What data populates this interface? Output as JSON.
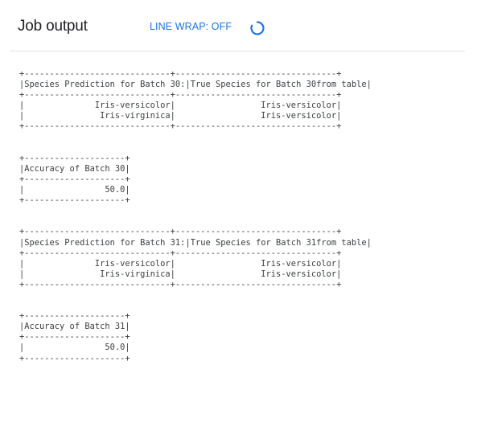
{
  "header": {
    "title": "Job output",
    "line_wrap_label": "LINE WRAP: OFF"
  },
  "icons": {
    "spinner": "loading-spinner-icon"
  },
  "colors": {
    "accent": "#1a73e8",
    "text": "#202124",
    "output_text": "#3c4043"
  },
  "output": {
    "tables": [
      {
        "lines": [
          "+-----------------------------+--------------------------------+",
          "|Species Prediction for Batch 30:|True Species for Batch 30from table|",
          "+-----------------------------+--------------------------------+",
          "|              Iris-versicolor|                 Iris-versicolor|",
          "|               Iris-virginica|                 Iris-versicolor|",
          "+-----------------------------+--------------------------------+"
        ]
      },
      {
        "lines": [
          "+--------------------+",
          "|Accuracy of Batch 30|",
          "+--------------------+",
          "|                50.0|",
          "+--------------------+"
        ]
      },
      {
        "lines": [
          "+-----------------------------+--------------------------------+",
          "|Species Prediction for Batch 31:|True Species for Batch 31from table|",
          "+-----------------------------+--------------------------------+",
          "|              Iris-versicolor|                 Iris-versicolor|",
          "|               Iris-virginica|                 Iris-versicolor|",
          "+-----------------------------+--------------------------------+"
        ]
      },
      {
        "lines": [
          "+--------------------+",
          "|Accuracy of Batch 31|",
          "+--------------------+",
          "|                50.0|",
          "+--------------------+"
        ]
      }
    ]
  }
}
